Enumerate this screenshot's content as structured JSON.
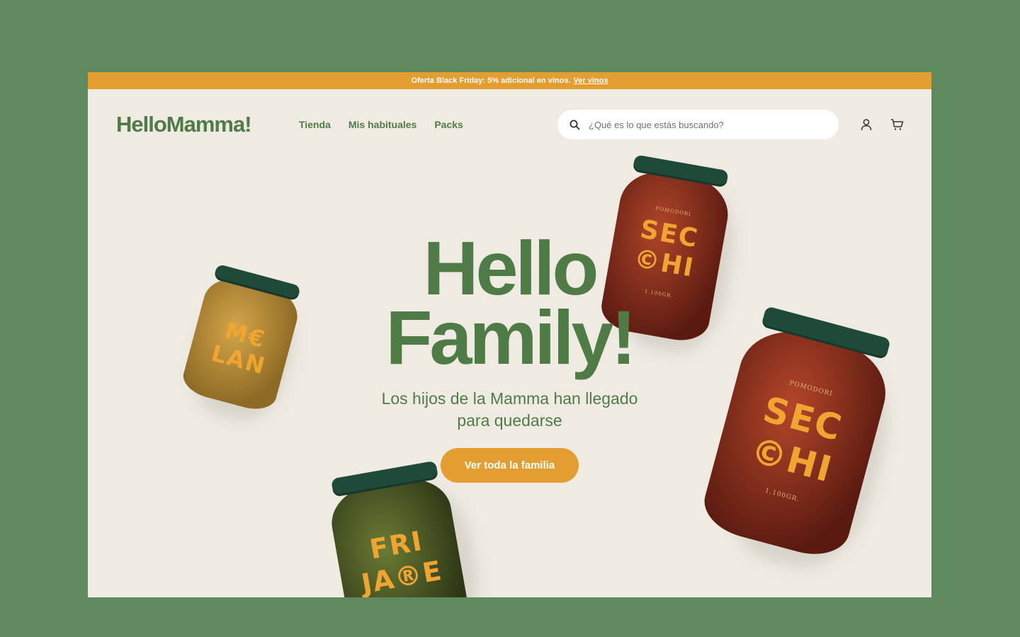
{
  "promo": {
    "text": "Oferta Black Friday: 5% adicional en vinos.",
    "link": "Ver vinos"
  },
  "brand": {
    "logo": "HelloMamma!"
  },
  "nav": [
    {
      "label": "Tienda"
    },
    {
      "label": "Mis habituales"
    },
    {
      "label": "Packs"
    }
  ],
  "search": {
    "placeholder": "¿Qué es lo que estás buscando?",
    "icon": "search-icon"
  },
  "header_icons": [
    "user-icon",
    "cart-icon"
  ],
  "hero": {
    "title_line1": "Hello",
    "title_line2": "Family!",
    "subtitle_line1": "Los hijos de la Mamma han llegado",
    "subtitle_line2": "para quedarse",
    "cta": "Ver toda la familia"
  },
  "jars": [
    {
      "name": "melanzane",
      "label_line1": "M€",
      "label_line2": "LAN"
    },
    {
      "name": "secchi-small",
      "label_line1": "SEC",
      "label_line2": "©HI",
      "top_text": "POMODORI",
      "weight": "1.100GR."
    },
    {
      "name": "secchi-large",
      "label_line1": "SEC",
      "label_line2": "©HI",
      "top_text": "POMODORI",
      "weight": "1.100GR."
    },
    {
      "name": "friarielli",
      "label_line1": "FRI",
      "label_line2": "JA®E"
    }
  ],
  "colors": {
    "background": "#5f8a5f",
    "page": "#efebe3",
    "brand_green": "#4f7c46",
    "accent_orange": "#e39d31",
    "lid_green": "#1f4a3a"
  }
}
